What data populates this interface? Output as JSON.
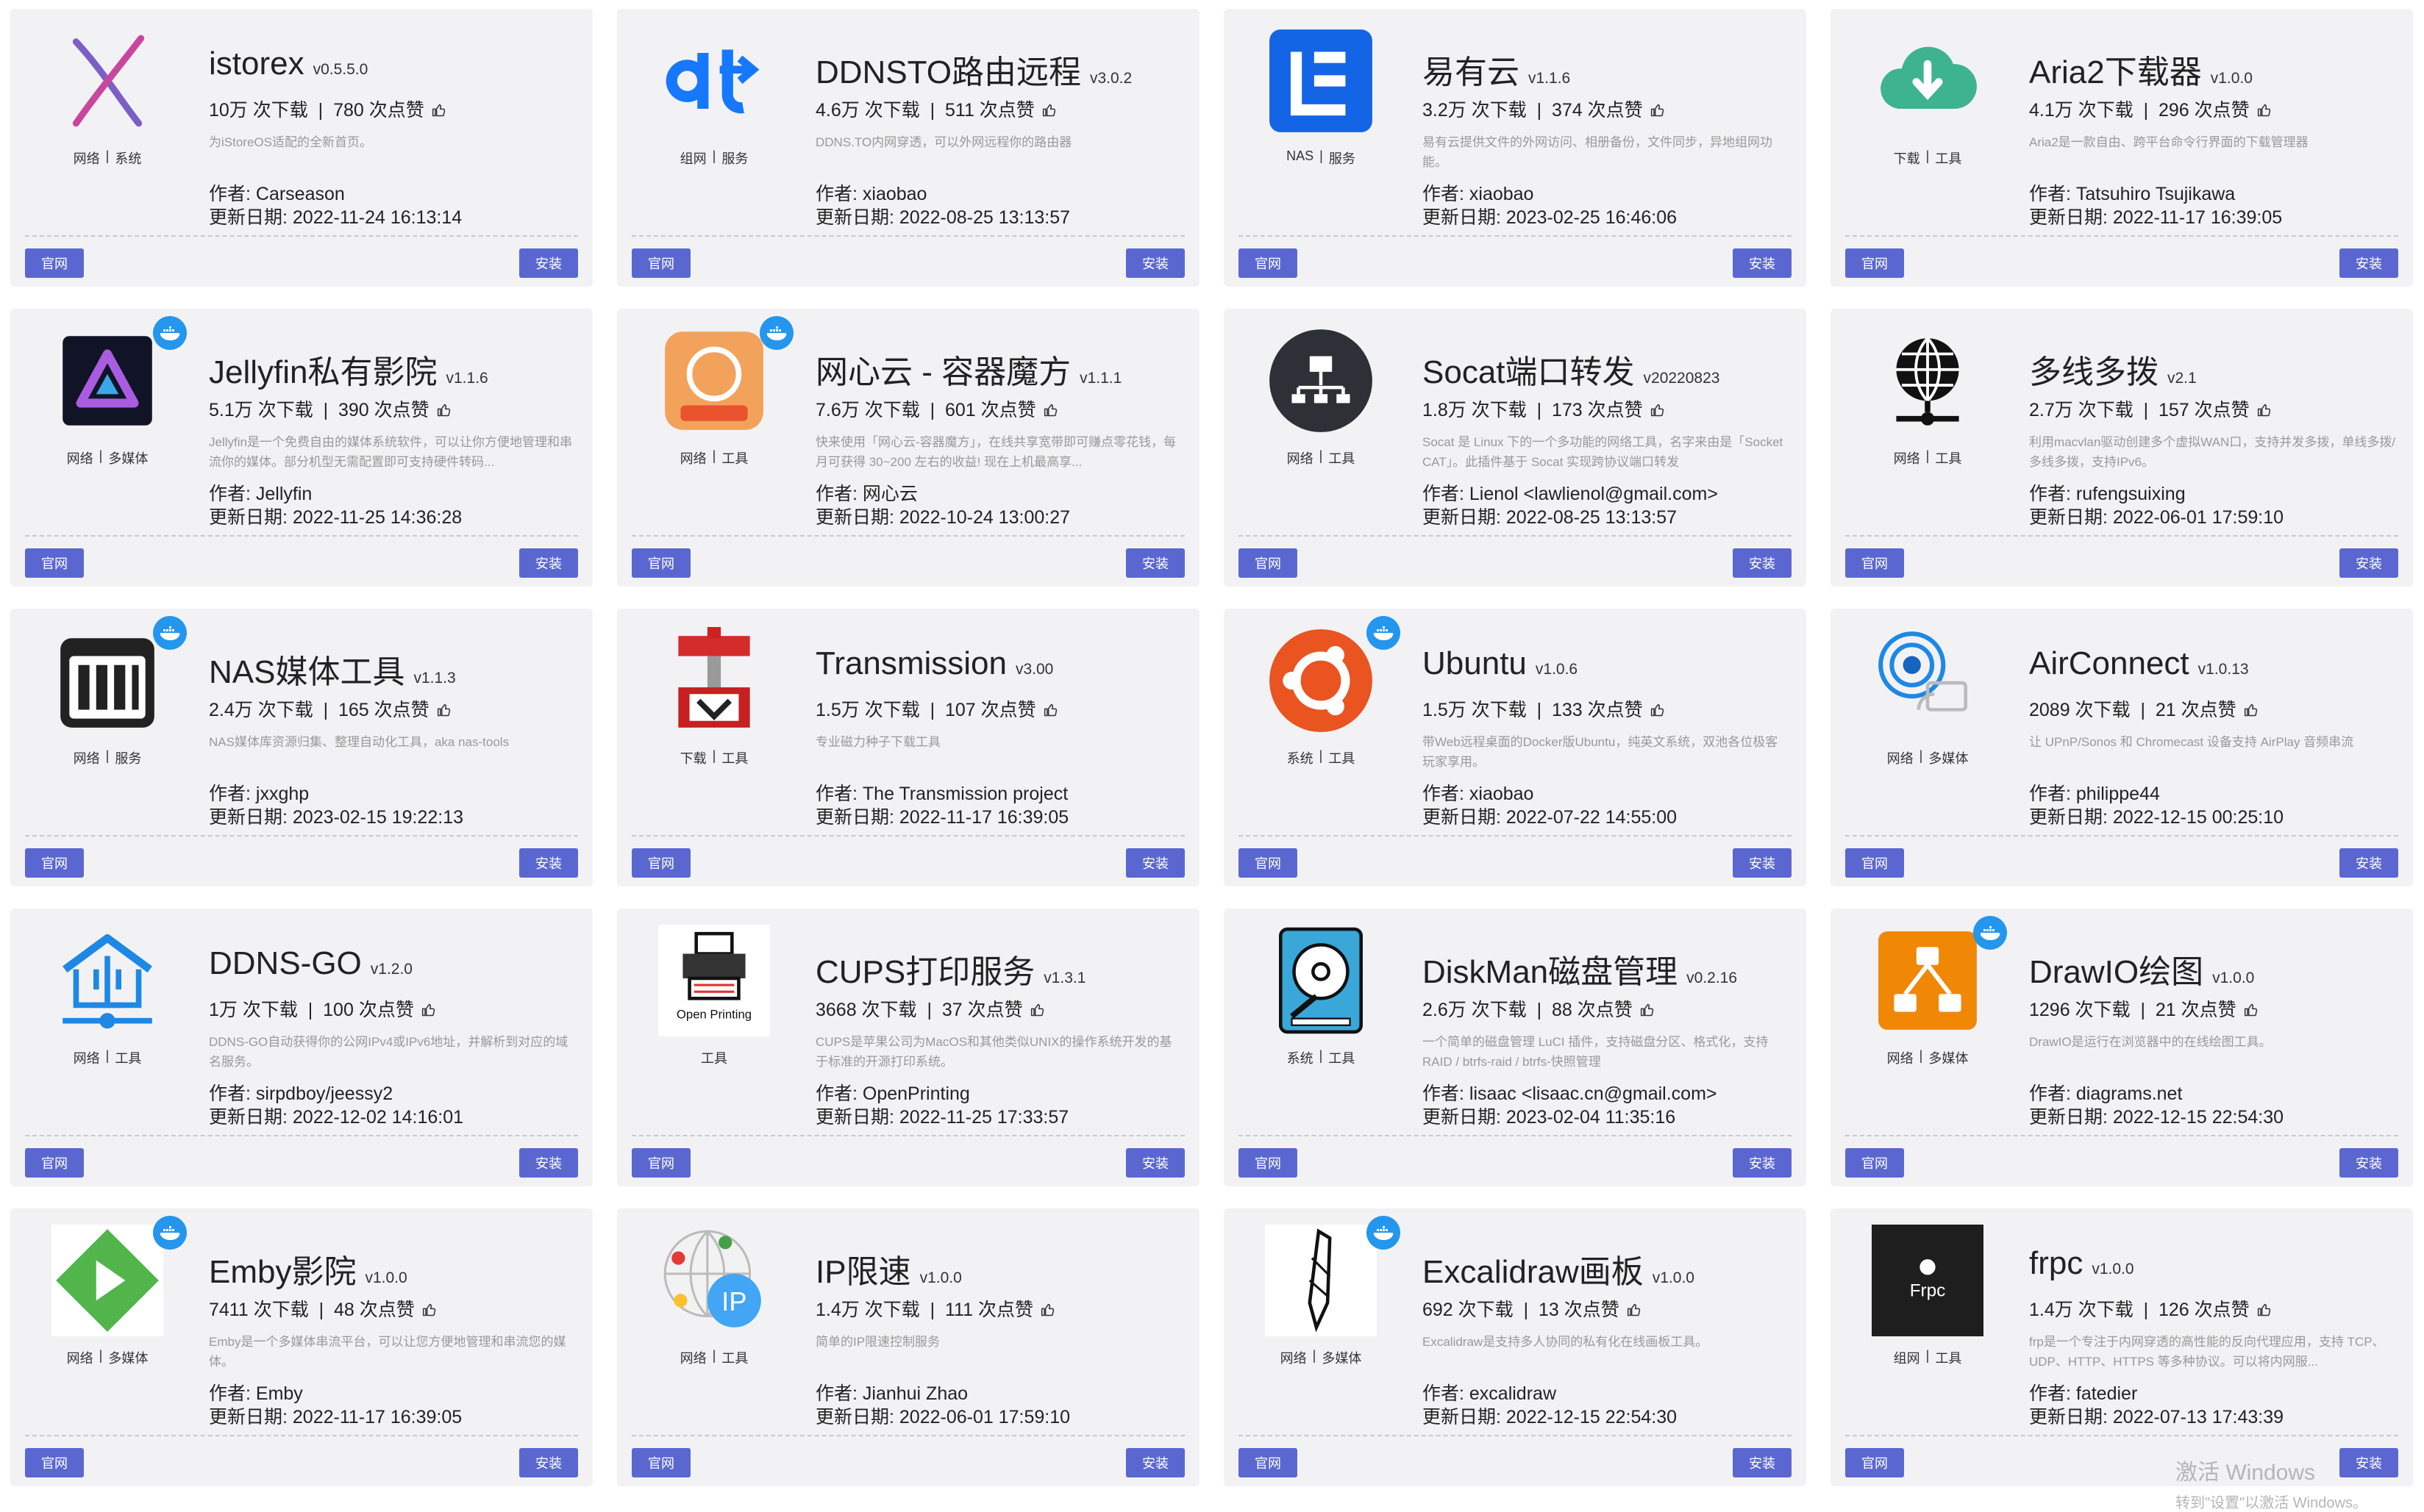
{
  "buttons": {
    "site": "官网",
    "install": "安装"
  },
  "author_prefix": "作者: ",
  "updated_prefix": "更新日期: ",
  "download_suffix": " 次下载",
  "likes_suffix": " 次点赞",
  "watermark": {
    "line1": "激活 Windows",
    "line2": "转到\"设置\"以激活 Windows。"
  },
  "apps": [
    {
      "title": "istorex",
      "version": "v0.5.5.0",
      "downloads": "10万",
      "likes": "780",
      "desc": "为iStoreOS适配的全新首页。",
      "author": "Carseason",
      "updated": "2022-11-24 16:13:14",
      "tags": [
        "网络",
        "系统"
      ],
      "icon": "istorex-icon",
      "docker": false
    },
    {
      "title": "DDNSTO路由远程",
      "version": "v3.0.2",
      "downloads": "4.6万",
      "likes": "511",
      "desc": "DDNS.TO内网穿透，可以外网远程你的路由器",
      "author": "xiaobao",
      "updated": "2022-08-25 13:13:57",
      "tags": [
        "组网",
        "服务"
      ],
      "icon": "ddnsto-icon",
      "docker": false
    },
    {
      "title": "易有云",
      "version": "v1.1.6",
      "downloads": "3.2万",
      "likes": "374",
      "desc": "易有云提供文件的外网访问、相册备份，文件同步，异地组网功能。",
      "author": "xiaobao",
      "updated": "2023-02-25 16:46:06",
      "tags": [
        "NAS",
        "服务"
      ],
      "icon": "yiyouyun-icon",
      "docker": false
    },
    {
      "title": "Aria2下载器",
      "version": "v1.0.0",
      "downloads": "4.1万",
      "likes": "296",
      "desc": "Aria2是一款自由、跨平台命令行界面的下载管理器",
      "author": "Tatsuhiro Tsujikawa",
      "updated": "2022-11-17 16:39:05",
      "tags": [
        "下载",
        "工具"
      ],
      "icon": "cloud-download-icon",
      "docker": false
    },
    {
      "title": "Jellyfin私有影院",
      "version": "v1.1.6",
      "downloads": "5.1万",
      "likes": "390",
      "desc": "Jellyfin是一个免费自由的媒体系统软件，可以让你方便地管理和串流你的媒体。部分机型无需配置即可支持硬件转码...",
      "author": "Jellyfin",
      "updated": "2022-11-25 14:36:28",
      "tags": [
        "网络",
        "多媒体"
      ],
      "icon": "jellyfin-icon",
      "docker": true
    },
    {
      "title": "网心云 - 容器魔方",
      "version": "v1.1.1",
      "downloads": "7.6万",
      "likes": "601",
      "desc": "快来使用「网心云-容器魔方」，在线共享宽带即可赚点零花钱，每月可获得 30~200 左右的收益! 现在上机最高享...",
      "author": "网心云",
      "updated": "2022-10-24 13:00:27",
      "tags": [
        "网络",
        "工具"
      ],
      "icon": "wangxinyun-icon",
      "docker": true
    },
    {
      "title": "Socat端口转发",
      "version": "v20220823",
      "downloads": "1.8万",
      "likes": "173",
      "desc": "Socat 是 Linux 下的一个多功能的网络工具，名字来由是「Socket CAT」。此插件基于 Socat 实现跨协议端口转发",
      "author": "Lienol <lawlienol@gmail.com>",
      "updated": "2022-08-25 13:13:57",
      "tags": [
        "网络",
        "工具"
      ],
      "icon": "network-icon",
      "docker": false
    },
    {
      "title": "多线多拨",
      "version": "v2.1",
      "downloads": "2.7万",
      "likes": "157",
      "desc": "利用macvlan驱动创建多个虚拟WAN口，支持并发多拨，单线多拨/多线多拨，支持IPv6。",
      "author": "rufengsuixing",
      "updated": "2022-06-01 17:59:10",
      "tags": [
        "网络",
        "工具"
      ],
      "icon": "globe-icon",
      "docker": false
    },
    {
      "title": "NAS媒体工具",
      "version": "v1.1.3",
      "downloads": "2.4万",
      "likes": "165",
      "desc": "NAS媒体库资源归集、整理自动化工具，aka nas-tools",
      "author": "jxxghp",
      "updated": "2023-02-15 19:22:13",
      "tags": [
        "网络",
        "服务"
      ],
      "icon": "nas-icon",
      "docker": true
    },
    {
      "title": "Transmission",
      "version": "v3.00",
      "downloads": "1.5万",
      "likes": "107",
      "desc": "专业磁力种子下载工具",
      "author": "The Transmission project",
      "updated": "2022-11-17 16:39:05",
      "tags": [
        "下载",
        "工具"
      ],
      "icon": "transmission-icon",
      "docker": false
    },
    {
      "title": "Ubuntu",
      "version": "v1.0.6",
      "downloads": "1.5万",
      "likes": "133",
      "desc": "带Web远程桌面的Docker版Ubuntu，纯英文系统，双池各位极客玩家享用。",
      "author": "xiaobao",
      "updated": "2022-07-22 14:55:00",
      "tags": [
        "系统",
        "工具"
      ],
      "icon": "ubuntu-icon",
      "docker": true
    },
    {
      "title": "AirConnect",
      "version": "v1.0.13",
      "downloads": "2089",
      "likes": "21",
      "desc": "让 UPnP/Sonos 和 Chromecast 设备支持 AirPlay 音频串流",
      "author": "philippe44",
      "updated": "2022-12-15 00:25:10",
      "tags": [
        "网络",
        "多媒体"
      ],
      "icon": "airconnect-icon",
      "docker": false
    },
    {
      "title": "DDNS-GO",
      "version": "v1.2.0",
      "downloads": "1万",
      "likes": "100",
      "desc": "DDNS-GO自动获得你的公网IPv4或IPv6地址，并解析到对应的域名服务。",
      "author": "sirpdboy/jeessy2",
      "updated": "2022-12-02 14:16:01",
      "tags": [
        "网络",
        "工具"
      ],
      "icon": "ddnsgo-icon",
      "docker": false
    },
    {
      "title": "CUPS打印服务",
      "version": "v1.3.1",
      "downloads": "3668",
      "likes": "37",
      "desc": "CUPS是苹果公司为MacOS和其他类似UNIX的操作系统开发的基于标准的开源打印系统。",
      "author": "OpenPrinting",
      "updated": "2022-11-25 17:33:57",
      "tags": [
        "工具"
      ],
      "icon": "printer-icon",
      "docker": false
    },
    {
      "title": "DiskMan磁盘管理",
      "version": "v0.2.16",
      "downloads": "2.6万",
      "likes": "88",
      "desc": "一个简单的磁盘管理 LuCI 插件，支持磁盘分区、格式化，支持 RAID / btrfs-raid / btrfs-快照管理",
      "author": "lisaac <lisaac.cn@gmail.com>",
      "updated": "2023-02-04 11:35:16",
      "tags": [
        "系统",
        "工具"
      ],
      "icon": "disk-icon",
      "docker": false
    },
    {
      "title": "DrawIO绘图",
      "version": "v1.0.0",
      "downloads": "1296",
      "likes": "21",
      "desc": "DrawIO是运行在浏览器中的在线绘图工具。",
      "author": "diagrams.net",
      "updated": "2022-12-15 22:54:30",
      "tags": [
        "网络",
        "多媒体"
      ],
      "icon": "drawio-icon",
      "docker": true
    },
    {
      "title": "Emby影院",
      "version": "v1.0.0",
      "downloads": "7411",
      "likes": "48",
      "desc": "Emby是一个多媒体串流平台，可以让您方便地管理和串流您的媒体。",
      "author": "Emby",
      "updated": "2022-11-17 16:39:05",
      "tags": [
        "网络",
        "多媒体"
      ],
      "icon": "emby-icon",
      "docker": true
    },
    {
      "title": "IP限速",
      "version": "v1.0.0",
      "downloads": "1.4万",
      "likes": "111",
      "desc": "简单的IP限速控制服务",
      "author": "Jianhui Zhao",
      "updated": "2022-06-01 17:59:10",
      "tags": [
        "网络",
        "工具"
      ],
      "icon": "ip-icon",
      "docker": false
    },
    {
      "title": "Excalidraw画板",
      "version": "v1.0.0",
      "downloads": "692",
      "likes": "13",
      "desc": "Excalidraw是支持多人协同的私有化在线画板工具。",
      "author": "excalidraw",
      "updated": "2022-12-15 22:54:30",
      "tags": [
        "网络",
        "多媒体"
      ],
      "icon": "excalidraw-icon",
      "docker": true
    },
    {
      "title": "frpc",
      "version": "v1.0.0",
      "downloads": "1.4万",
      "likes": "126",
      "desc": "frp是一个专注于内网穿透的高性能的反向代理应用，支持 TCP、UDP、HTTP、HTTPS 等多种协议。可以将内网服...",
      "author": "fatedier",
      "updated": "2022-07-13 17:43:39",
      "tags": [
        "组网",
        "工具"
      ],
      "icon": "frpc-icon",
      "docker": false
    }
  ]
}
